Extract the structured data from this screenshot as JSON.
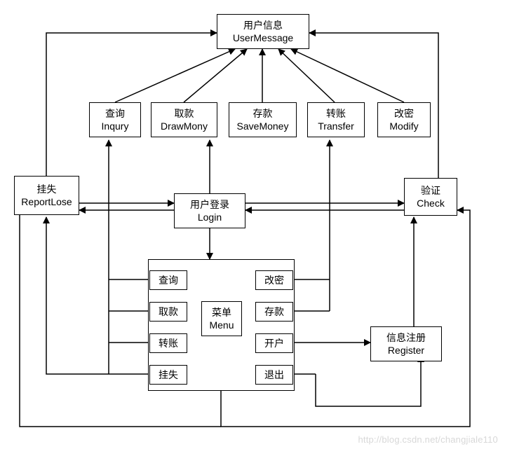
{
  "user_message": {
    "line1": "用户信息",
    "line2": "UserMessage"
  },
  "ops": {
    "inquiry": {
      "line1": "查询",
      "line2": "Inqury"
    },
    "drawmoney": {
      "line1": "取款",
      "line2": "DrawMony"
    },
    "savemoney": {
      "line1": "存款",
      "line2": "SaveMoney"
    },
    "transfer": {
      "line1": "转账",
      "line2": "Transfer"
    },
    "modify": {
      "line1": "改密",
      "line2": "Modify"
    }
  },
  "report_lose": {
    "line1": "挂失",
    "line2": "ReportLose"
  },
  "login": {
    "line1": "用户登录",
    "line2": "Login"
  },
  "check": {
    "line1": "验证",
    "line2": "Check"
  },
  "register": {
    "line1": "信息注册",
    "line2": "Register"
  },
  "menu": {
    "center": {
      "line1": "菜单",
      "line2": "Menu"
    },
    "left": [
      "查询",
      "取款",
      "转账",
      "挂失"
    ],
    "right": [
      "改密",
      "存款",
      "开户",
      "退出"
    ]
  },
  "watermark": "http://blog.csdn.net/changjiale110"
}
